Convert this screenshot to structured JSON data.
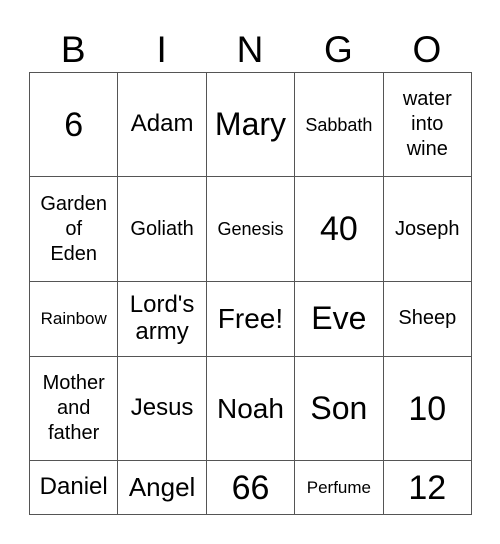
{
  "header": {
    "letters": [
      "B",
      "I",
      "N",
      "G",
      "O"
    ]
  },
  "grid": [
    [
      {
        "text": "6"
      },
      {
        "text": "Adam"
      },
      {
        "text": "Mary"
      },
      {
        "text": "Sabbath"
      },
      {
        "text": "water\ninto\nwine"
      }
    ],
    [
      {
        "text": "Garden\nof\nEden"
      },
      {
        "text": "Goliath"
      },
      {
        "text": "Genesis"
      },
      {
        "text": "40"
      },
      {
        "text": "Joseph"
      }
    ],
    [
      {
        "text": "Rainbow"
      },
      {
        "text": "Lord's\narmy"
      },
      {
        "text": "Free!"
      },
      {
        "text": "Eve"
      },
      {
        "text": "Sheep"
      }
    ],
    [
      {
        "text": "Mother\nand\nfather"
      },
      {
        "text": "Jesus"
      },
      {
        "text": "Noah"
      },
      {
        "text": "Son"
      },
      {
        "text": "10"
      }
    ],
    [
      {
        "text": "Daniel"
      },
      {
        "text": "Angel"
      },
      {
        "text": "66"
      },
      {
        "text": "Perfume"
      },
      {
        "text": "12"
      }
    ]
  ]
}
